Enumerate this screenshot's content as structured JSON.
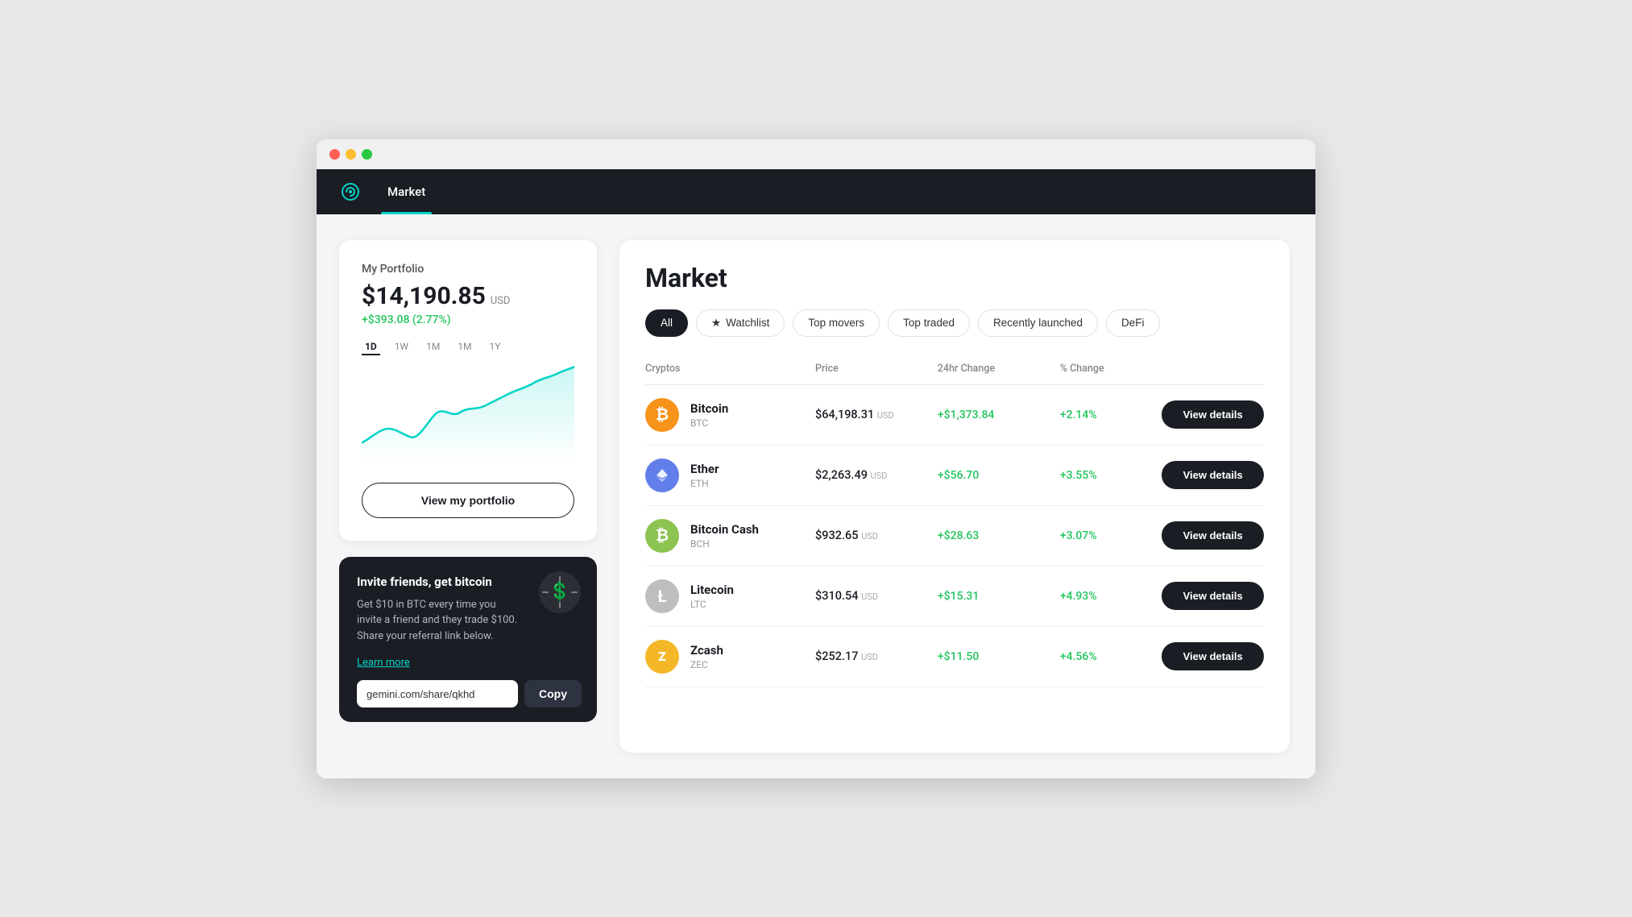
{
  "browser": {
    "traffic_lights": [
      "red",
      "yellow",
      "green"
    ]
  },
  "nav": {
    "logo_icon": "♾",
    "items": [
      {
        "label": "Market",
        "active": true
      }
    ]
  },
  "portfolio": {
    "title": "My Portfolio",
    "amount": "$14,190.85",
    "currency": "USD",
    "change": "+$393.08 (2.77%)",
    "timeframes": [
      "1D",
      "1W",
      "1M",
      "1M",
      "1Y"
    ],
    "active_timeframe": "1D",
    "view_button": "View my portfolio"
  },
  "referral": {
    "title": "Invite friends, get bitcoin",
    "description": "Get $10 in BTC every time you invite a friend and they trade $100. Share your referral link below.",
    "learn_more": "Learn more",
    "link_value": "gemini.com/share/qkhd",
    "copy_button": "Copy"
  },
  "market": {
    "title": "Market",
    "filters": [
      {
        "label": "All",
        "active": true,
        "icon": ""
      },
      {
        "label": "Watchlist",
        "active": false,
        "icon": "★"
      },
      {
        "label": "Top movers",
        "active": false,
        "icon": ""
      },
      {
        "label": "Top traded",
        "active": false,
        "icon": ""
      },
      {
        "label": "Recently launched",
        "active": false,
        "icon": ""
      },
      {
        "label": "DeFi",
        "active": false,
        "icon": ""
      }
    ],
    "table": {
      "headers": [
        "Cryptos",
        "Price",
        "24hr Change",
        "% Change",
        ""
      ],
      "rows": [
        {
          "name": "Bitcoin",
          "symbol": "BTC",
          "icon_bg": "#f7931a",
          "icon_text": "₿",
          "price": "$64,198.31",
          "price_currency": "USD",
          "change_24h": "+$1,373.84",
          "change_pct": "+2.14%",
          "button": "View details"
        },
        {
          "name": "Ether",
          "symbol": "ETH",
          "icon_bg": "#627eea",
          "icon_text": "◆",
          "price": "$2,263.49",
          "price_currency": "USD",
          "change_24h": "+$56.70",
          "change_pct": "+3.55%",
          "button": "View details"
        },
        {
          "name": "Bitcoin Cash",
          "symbol": "BCH",
          "icon_bg": "#8dc351",
          "icon_text": "₿",
          "price": "$932.65",
          "price_currency": "USD",
          "change_24h": "+$28.63",
          "change_pct": "+3.07%",
          "button": "View details"
        },
        {
          "name": "Litecoin",
          "symbol": "LTC",
          "icon_bg": "#bebebe",
          "icon_text": "Ł",
          "price": "$310.54",
          "price_currency": "USD",
          "change_24h": "+$15.31",
          "change_pct": "+4.93%",
          "button": "View details"
        },
        {
          "name": "Zcash",
          "symbol": "ZEC",
          "icon_bg": "#f4b728",
          "icon_text": "⟠",
          "price": "$252.17",
          "price_currency": "USD",
          "change_24h": "+$11.50",
          "change_pct": "+4.56%",
          "button": "View details"
        }
      ]
    }
  }
}
